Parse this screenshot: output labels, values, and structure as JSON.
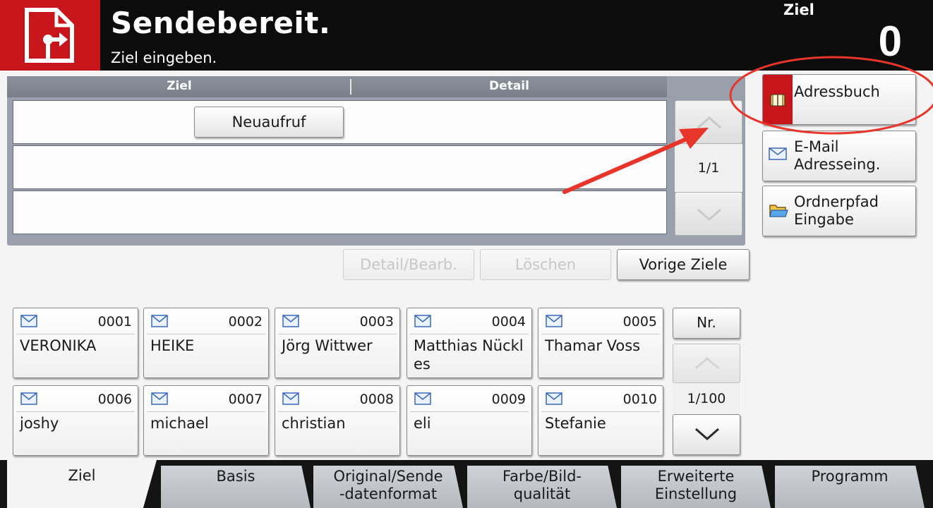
{
  "header": {
    "title": "Sendebereit.",
    "subtitle": "Ziel eingeben.",
    "count_label": "Ziel",
    "count_value": "0"
  },
  "destination": {
    "col_ziel": "Ziel",
    "col_detail": "Detail",
    "recall_button": "Neuaufruf",
    "page": "1/1"
  },
  "side": {
    "addressbook": "Adressbuch",
    "email_entry": "E-Mail\nAdresseing.",
    "folder_entry": "Ordnerpfad\nEingabe"
  },
  "actions": {
    "detail_edit": "Detail/Bearb.",
    "delete": "Löschen",
    "previous": "Vorige Ziele"
  },
  "contacts": [
    {
      "number": "0001",
      "name": "VERONIKA",
      "icon": "envelope-icon"
    },
    {
      "number": "0002",
      "name": "HEIKE",
      "icon": "envelope-icon"
    },
    {
      "number": "0003",
      "name": "Jörg Wittwer",
      "icon": "envelope-icon"
    },
    {
      "number": "0004",
      "name": "Matthias Nückles",
      "icon": "envelope-icon"
    },
    {
      "number": "0005",
      "name": "Thamar Voss",
      "icon": "envelope-icon"
    },
    {
      "number": "0006",
      "name": "joshy",
      "icon": "envelope-icon"
    },
    {
      "number": "0007",
      "name": "michael",
      "icon": "envelope-icon"
    },
    {
      "number": "0008",
      "name": "christian",
      "icon": "envelope-icon"
    },
    {
      "number": "0009",
      "name": "eli",
      "icon": "envelope-icon"
    },
    {
      "number": "0010",
      "name": "Stefanie",
      "icon": "envelope-icon"
    }
  ],
  "list": {
    "sort_button": "Nr.",
    "page": "1/100"
  },
  "tabs": [
    {
      "label": "Ziel",
      "active": true
    },
    {
      "label": "Basis",
      "active": false
    },
    {
      "label": "Original/Sende\n-datenformat",
      "active": false
    },
    {
      "label": "Farbe/Bild-\nqualität",
      "active": false
    },
    {
      "label": "Erweiterte\nEinstellung",
      "active": false
    },
    {
      "label": "Programm",
      "active": false
    }
  ],
  "colors": {
    "brand_red": "#c8151b",
    "header_bg": "#0c0c0c",
    "annotation_red": "#e8352b"
  }
}
